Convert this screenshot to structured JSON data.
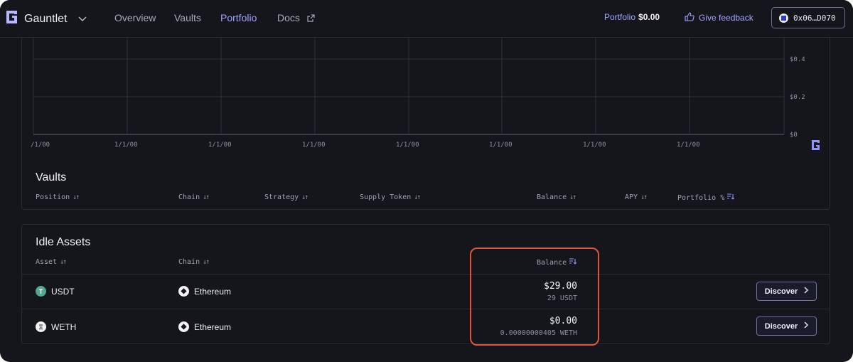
{
  "nav": {
    "brand": "Gauntlet",
    "links": [
      "Overview",
      "Vaults",
      "Portfolio",
      "Docs"
    ],
    "portfolio_label": "Portfolio",
    "portfolio_value": "$0.00",
    "feedback": "Give feedback",
    "wallet": "0x06…D070"
  },
  "chart": {
    "y_ticks": [
      "$0.4",
      "$0.2",
      "$0"
    ],
    "x_ticks": [
      "/1/00",
      "1/1/00",
      "1/1/00",
      "1/1/00",
      "1/1/00",
      "1/1/00",
      "1/1/00",
      "1/1/00"
    ]
  },
  "chart_data": {
    "type": "line",
    "x": [
      "1/1/00",
      "1/1/00",
      "1/1/00",
      "1/1/00",
      "1/1/00",
      "1/1/00",
      "1/1/00",
      "1/1/00"
    ],
    "series": [],
    "ylim": [
      0,
      0.5
    ],
    "grid": true
  },
  "vaults": {
    "title": "Vaults",
    "columns": [
      "Position",
      "Chain",
      "Strategy",
      "Supply Token",
      "Balance",
      "APY",
      "Portfolio %"
    ]
  },
  "idle": {
    "title": "Idle Assets",
    "columns": [
      "Asset",
      "Chain",
      "Balance"
    ],
    "rows": [
      {
        "asset": "USDT",
        "chain": "Ethereum",
        "balance": "$29.00",
        "amount": "29 USDT",
        "action": "Discover"
      },
      {
        "asset": "WETH",
        "chain": "Ethereum",
        "balance": "$0.00",
        "amount": "0.00000000405 WETH",
        "action": "Discover"
      }
    ]
  },
  "colors": {
    "background": "#15151c",
    "accent": "#9ea4ff",
    "highlight": "#e2533a"
  }
}
